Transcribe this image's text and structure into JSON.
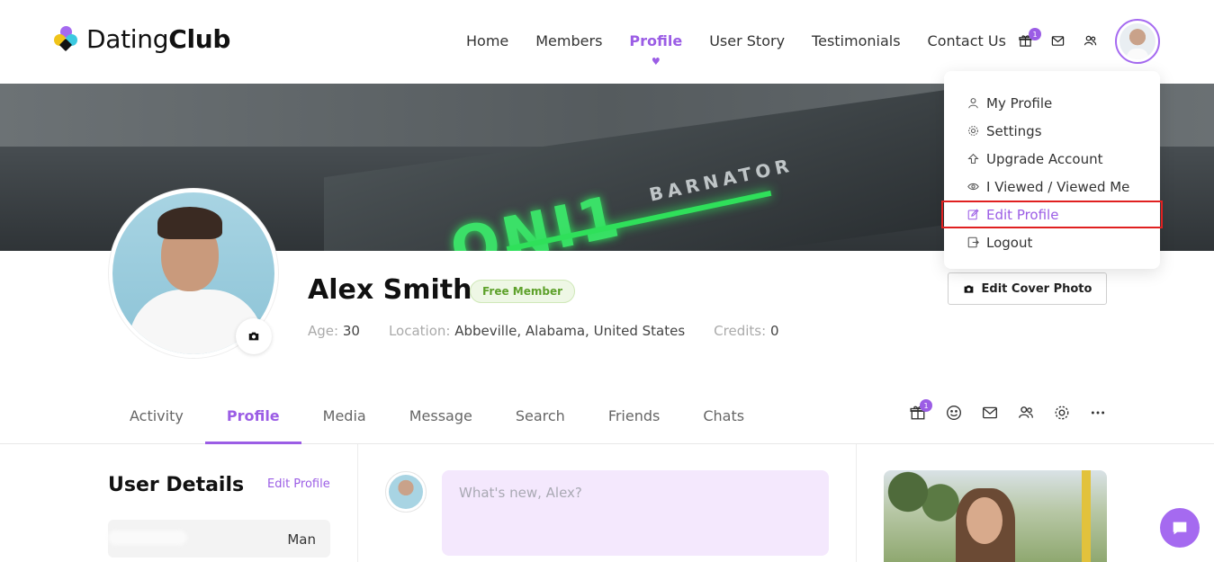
{
  "logo": {
    "text_regular": "Dating",
    "text_bold": "Club"
  },
  "nav": {
    "items": [
      {
        "label": "Home"
      },
      {
        "label": "Members"
      },
      {
        "label": "Profile",
        "active": true
      },
      {
        "label": "User Story"
      },
      {
        "label": "Testimonials"
      },
      {
        "label": "Contact Us"
      }
    ]
  },
  "header_icons": {
    "gift_badge": "1"
  },
  "user_menu": {
    "items": [
      {
        "label": "My Profile",
        "icon": "user-icon"
      },
      {
        "label": "Settings",
        "icon": "gear-icon"
      },
      {
        "label": "Upgrade Account",
        "icon": "arrow-up-icon"
      },
      {
        "label": "I Viewed / Viewed Me",
        "icon": "eye-icon"
      },
      {
        "label": "Edit Profile",
        "icon": "edit-icon",
        "highlighted": true
      },
      {
        "label": "Logout",
        "icon": "logout-icon"
      }
    ]
  },
  "profile": {
    "name": "Alex Smith",
    "badge": "Free Member",
    "age_label": "Age:",
    "age": "30",
    "location_label": "Location:",
    "location": "Abbeville, Alabama, United States",
    "credits_label": "Credits:",
    "credits": "0",
    "edit_cover_label": "Edit Cover Photo"
  },
  "tabs": {
    "items": [
      {
        "label": "Activity"
      },
      {
        "label": "Profile",
        "active": true
      },
      {
        "label": "Media"
      },
      {
        "label": "Message"
      },
      {
        "label": "Search"
      },
      {
        "label": "Friends"
      },
      {
        "label": "Chats"
      }
    ],
    "gift_badge": "1"
  },
  "user_details": {
    "title": "User Details",
    "edit_label": "Edit Profile",
    "rows": [
      {
        "value": "Man"
      }
    ]
  },
  "composer": {
    "placeholder": "What's new, Alex?"
  },
  "colors": {
    "accent": "#9b5de5",
    "badge_green": "#5ea12b",
    "highlight_border": "#e02020"
  }
}
